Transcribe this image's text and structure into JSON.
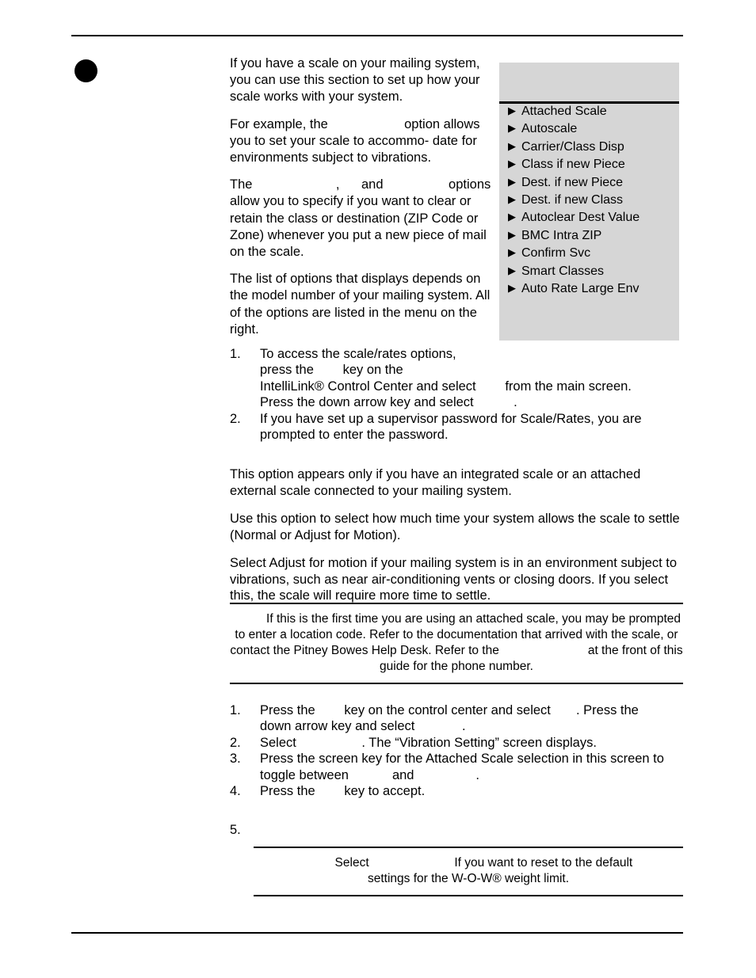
{
  "page": {
    "bullet_icon": "filled-circle-bullet",
    "section_heading": ""
  },
  "intro": {
    "paragraphs": [
      "If you have a scale on your mailing system, you can use this section to set up how your scale works with your system.",
      "For example, the  option allows you to set your scale to accommo-date for environments subject to vibrations.",
      "The ,  and  options allow you to specify if you want to clear or retain the class or destination (ZIP Code or Zone) whenever you put a new piece of mail on the scale.",
      "The list of options that displays depends on the model number of your mailing system. All of the options are listed in the menu on the right."
    ],
    "p1_l1": "If you have a scale on your mailing system,",
    "p1_l2": "you can use this section to set up how your",
    "p1_l3": "scale works with your system.",
    "p2_a": "For example, the",
    "p2_hidden1": "                     ",
    "p2_b": "option",
    "p2_l2": "allows you to set your scale to accommo-",
    "p2_l3": "date for environments subject to vibrations.",
    "p3_a": "The",
    "p3_hidden1": "                       ",
    "p3_comma": ",",
    "p3_hidden2": "      ",
    "p3_and": "and",
    "p3_hidden3": "                  ",
    "p3_b": "options allow",
    "p3_l2": "you to specify if you want to clear or retain",
    "p3_l3": "the class or destination (ZIP Code or Zone)",
    "p3_l4": "whenever you put a new piece of mail on",
    "p3_l5": "the scale.",
    "p4_l1": "The list of options that displays depends on",
    "p4_l2": "the model number of your mailing system.",
    "p4_l3": "All of the options are listed in the menu on",
    "p4_l4": "the right."
  },
  "menu_panel": {
    "title": "",
    "arrow_icon": "right-triangle-icon",
    "items": [
      "Attached Scale",
      "Autoscale",
      "Carrier/Class Disp",
      "Class if new Piece",
      "Dest. if new Piece",
      "Dest. if new Class",
      "Autoclear Dest Value",
      "BMC Intra ZIP",
      "Confirm Svc",
      "Smart Classes",
      "Auto Rate Large Env"
    ]
  },
  "steps_access": {
    "items": [
      {
        "number": "1.",
        "l1": "To access the scale/rates options,",
        "l2_a": "press the",
        "l2_hidden": "        ",
        "l2_b": "key on the",
        "l3_a": "IntelliLink® Control Center and select",
        "l3_hidden": "        ",
        "l3_b": "from the main screen.",
        "l4_a": "Press the down arrow key and select",
        "l4_hidden": "           ",
        "l4_b": "."
      },
      {
        "number": "2.",
        "l1": "If you have set up a supervisor password for Scale/Rates, you are",
        "l2_a": "prompted to enter the password.",
        "l2_hidden": "",
        "l2_b": ""
      }
    ]
  },
  "attached_scale": {
    "heading": "",
    "paragraphs": [
      "This option appears only if you have an integrated scale or an attached external scale connected to your mailing system.",
      "Use this option to select how much time your system allows the scale to settle (Normal or Adjust for Motion).",
      "Select Adjust for motion if your mailing system is in an environment subject to vibrations, such as near air-conditioning vents or closing doors. If you select this, the scale will require more time to settle."
    ],
    "p1_l1": "This option appears only if you have an integrated scale or an attached",
    "p1_l2": "external scale connected to your mailing system.",
    "p2_l1": "Use this option to select how much time your system allows the scale to",
    "p2_l2": "settle (Normal or Adjust for Motion).",
    "p3_l1": "Select Adjust for motion if your mailing system is in an environment subject",
    "p3_l2": "to vibrations, such as near air-conditioning vents or closing doors. If you",
    "p3_l3": "select this, the scale will require more time to settle."
  },
  "note_1": {
    "label_hidden": "          ",
    "l1": "If this is the first time you are using an attached scale, you may be",
    "l2": "prompted to enter a location code. Refer to the documentation that arrived with",
    "l3_a": "the scale, or contact the Pitney Bowes Help Desk. Refer to the",
    "l4_hidden": "                          ",
    "l4_b": "at the front of this guide for the phone number."
  },
  "steps_vibration": {
    "items": [
      {
        "number": "1.",
        "l1_a": "Press the",
        "l1_hidden1": "        ",
        "l1_b": "key on the control center and select",
        "l1_hidden2": "       ",
        "l1_c": ". Press the",
        "l2_a": "down arrow key and select",
        "l2_hidden": "             ",
        "l2_b": "."
      },
      {
        "number": "2.",
        "l1_a": "Select",
        "l1_hidden1": "                  ",
        "l1_b": ". The “Vibration Setting” screen displays.",
        "l1_hidden2": "",
        "l1_c": ""
      },
      {
        "number": "3.",
        "l1_a": "Press the screen key for the Attached Scale selection in this screen to",
        "l1_hidden1": "",
        "l1_b": "",
        "l1_hidden2": "",
        "l1_c": "",
        "l2_a": "toggle between",
        "l2_hidden": "            ",
        "l2_b": "and",
        "l2_hidden2": "                 ",
        "l2_c": "."
      },
      {
        "number": "4.",
        "l1_a": "Press the",
        "l1_hidden1": "        ",
        "l1_b": "key to accept.",
        "l1_hidden2": "",
        "l1_c": ""
      }
    ],
    "step5_number": "5.",
    "step5_text": ""
  },
  "note_2": {
    "label_hidden": "         ",
    "l1_a": "Select",
    "l1_hidden": "                         ",
    "l1_b": "If you want to reset to the default",
    "l2": "settings for the W-O-W® weight limit."
  },
  "colors": {
    "panel_background": "#d6d6d6",
    "rule": "#000000",
    "text": "#000000"
  }
}
